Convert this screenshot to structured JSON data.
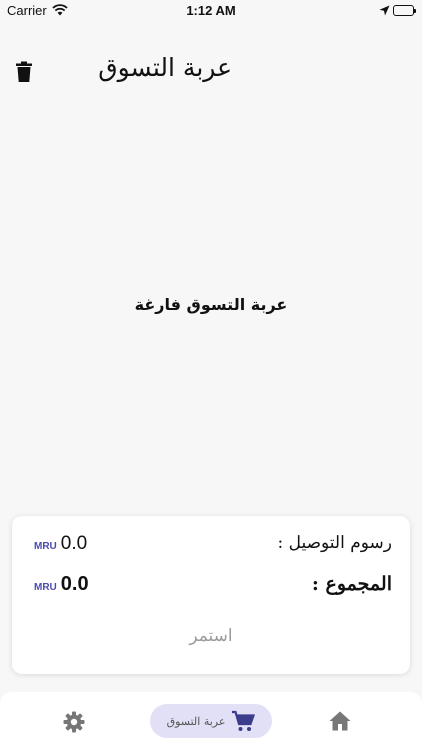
{
  "status_bar": {
    "carrier": "Carrier",
    "time": "1:12 AM",
    "icons": [
      "wifi-icon",
      "location-arrow-icon",
      "battery-icon"
    ]
  },
  "header": {
    "title": "عربة التسوق",
    "trash_icon": "trash-icon"
  },
  "cart": {
    "empty_message": "عربة التسوق فارغة"
  },
  "summary": {
    "delivery_fee_label": "رسوم التوصيل :",
    "delivery_fee_value": "0.0",
    "delivery_fee_currency": "MRU",
    "total_label": "المجموع :",
    "total_value": "0.0",
    "total_currency": "MRU",
    "continue_label": "استمر"
  },
  "bottom_nav": {
    "items": [
      {
        "icon": "settings-gear-icon"
      },
      {
        "icon": "cart-icon",
        "label": "عربة التسوق",
        "active": true
      },
      {
        "icon": "home-icon"
      }
    ]
  },
  "colors": {
    "background": "#f7f7f7",
    "card": "#ffffff",
    "currency_accent": "#4a4ab0",
    "active_nav_bg": "#e2e0f6",
    "muted_text": "#9b9b9b",
    "icon_gray": "#777777"
  }
}
